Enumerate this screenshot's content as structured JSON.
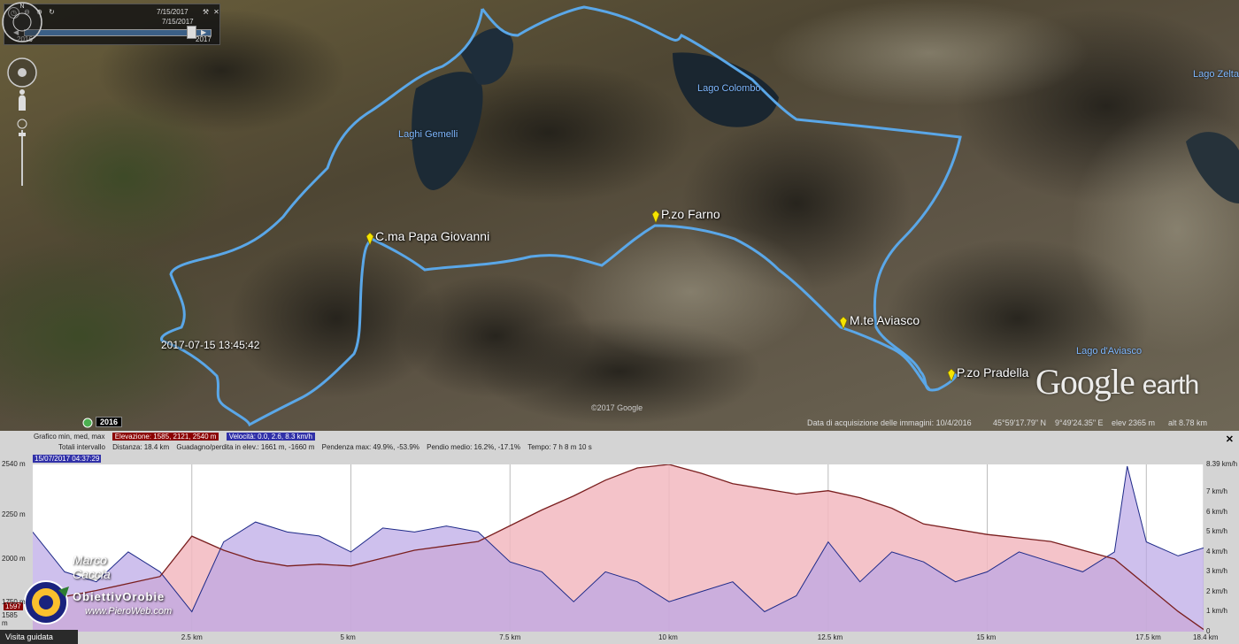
{
  "time_slider": {
    "date_top": "7/15/2017",
    "date_second": "7/15/2017",
    "year_start": "2016",
    "year_end": "2017"
  },
  "map": {
    "lakes": [
      "Laghi Gemelli",
      "Lago Colombo",
      "Lago Zelta",
      "Lago d'Aviasco"
    ],
    "peaks": [
      "C.ma Papa Giovanni",
      "P.zo Farno",
      "M.te Aviasco",
      "P.zo Pradella"
    ],
    "timestamp": "2017-07-15 13:45:42",
    "copyright": "©2017 Google",
    "year_badge": "2016",
    "logo_google": "Google",
    "logo_earth": "earth",
    "route_color": "#5aa7e8"
  },
  "status": {
    "acq_label": "Data di acquisizione delle immagini: 10/4/2016",
    "lat": "45°59'17.79\" N",
    "lon": "9°49'24.35\" E",
    "elev": "elev  2365 m",
    "alt": "alt  8.78 km"
  },
  "profile": {
    "row1_label": "Grafico  min, med, max",
    "elev_label": "Elevazione: 1585, 2121, 2540 m",
    "speed_label": "Velocità: 0.0, 2.6, 8.3 km/h",
    "row2_label": "Totali intervallo",
    "distance": "Distanza: 18.4 km",
    "gain_loss": "Guadagno/perdita in elev.: 1661 m, -1660 m",
    "slope_max": "Pendenza max: 49.9%, -53.9%",
    "slope_avg": "Pendio medio: 16.2%, -17.1%",
    "time": "Tempo: 7 h 8 m 10 s",
    "date_badge": "15/07/2017 04:37:29",
    "close": "✕",
    "current_elev": "1597",
    "min_elev_mark": "1585 m",
    "visita": "Visita guidata",
    "brand_author": "Marco Caccia",
    "brand_name": "ObiettivOrobie",
    "brand_url": "www.PieroWeb.com"
  },
  "chart_data": {
    "type": "area",
    "x_ticks": [
      "2.5 km",
      "5 km",
      "7.5 km",
      "10 km",
      "12.5 km",
      "15 km",
      "17.5 km",
      "18.4 km"
    ],
    "x_tick_values": [
      2.5,
      5,
      7.5,
      10,
      12.5,
      15,
      17.5,
      18.4
    ],
    "y_left_ticks": [
      "2540 m",
      "2250 m",
      "2000 m",
      "1750 m"
    ],
    "y_left_values": [
      2540,
      2250,
      2000,
      1750
    ],
    "y_right_ticks": [
      "8.39 km/h",
      "7 km/h",
      "6 km/h",
      "5 km/h",
      "4 km/h",
      "3 km/h",
      "2 km/h",
      "1 km/h",
      "0"
    ],
    "y_right_values": [
      8.39,
      7,
      6,
      5,
      4,
      3,
      2,
      1,
      0
    ],
    "xlim": [
      0,
      18.4
    ],
    "ylim_left": [
      1585,
      2540
    ],
    "ylim_right": [
      0,
      8.39
    ],
    "elevation": {
      "x": [
        0,
        1,
        2,
        2.5,
        3,
        3.5,
        4,
        4.5,
        5,
        6,
        7,
        8,
        8.5,
        9,
        9.5,
        10,
        10.5,
        11,
        11.5,
        12,
        12.5,
        13,
        13.5,
        14,
        15,
        16,
        17,
        17.5,
        18,
        18.4
      ],
      "y": [
        1750,
        1820,
        1900,
        2130,
        2050,
        1990,
        1960,
        1970,
        1960,
        2050,
        2100,
        2280,
        2360,
        2450,
        2520,
        2540,
        2490,
        2430,
        2400,
        2370,
        2390,
        2350,
        2290,
        2200,
        2140,
        2100,
        2000,
        1850,
        1700,
        1597
      ]
    },
    "speed": {
      "x": [
        0,
        0.5,
        1,
        1.5,
        2,
        2.5,
        3,
        3.5,
        4,
        4.5,
        5,
        5.5,
        6,
        6.5,
        7,
        7.5,
        8,
        8.5,
        9,
        9.5,
        10,
        10.5,
        11,
        11.5,
        12,
        12.5,
        13,
        13.5,
        14,
        14.5,
        15,
        15.5,
        16,
        16.5,
        17,
        17.2,
        17.5,
        18,
        18.4
      ],
      "y": [
        5,
        3,
        2.5,
        4,
        3,
        1,
        4.5,
        5.5,
        5,
        4.8,
        4,
        5.2,
        5,
        5.3,
        5,
        3.5,
        3,
        1.5,
        3,
        2.5,
        1.5,
        2,
        2.5,
        1,
        1.8,
        4.5,
        2.5,
        4,
        3.5,
        2.5,
        3,
        4,
        3.5,
        3,
        4,
        8.3,
        4.5,
        3.8,
        4.2
      ]
    },
    "elevation_color": "#7a1f1f",
    "speed_color": "#1e2a88"
  },
  "colors": {
    "panel_bg": "#d4d4d4",
    "elev_fill": "#f2b8bf",
    "speed_fill": "#b9a5e6"
  }
}
